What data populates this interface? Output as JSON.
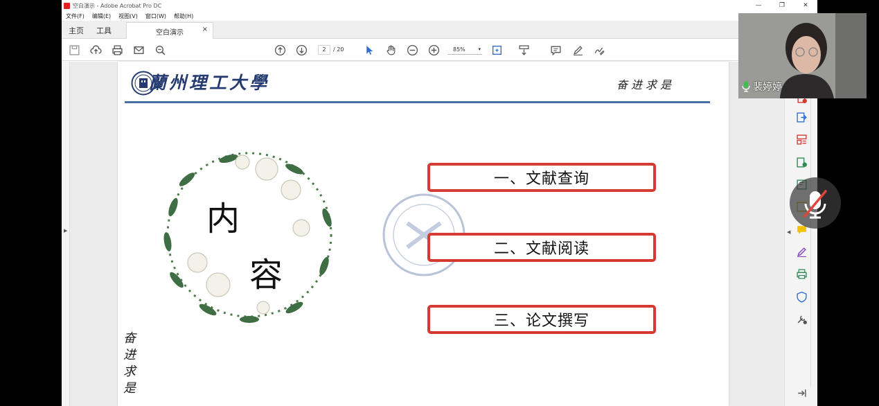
{
  "window": {
    "title": "空白演示 - Adobe Acrobat Pro DC",
    "minimize": "—",
    "restore": "❐",
    "close": "✕"
  },
  "menu": [
    "文件(F)",
    "编辑(E)",
    "视图(V)",
    "窗口(W)",
    "帮助(H)"
  ],
  "tabs": {
    "home": "主页",
    "tools": "工具",
    "doc": "空白演示",
    "doc_close": "×"
  },
  "toolbar": {
    "page_current": "2",
    "page_total": "/ 20",
    "zoom": "85%",
    "zoom_arrow": "▾"
  },
  "slide": {
    "university": "蘭州理工大學",
    "motto": "奋进求是",
    "motto_vertical": "奋进求是",
    "content_chars": [
      "内",
      "容"
    ],
    "items": [
      "一、文献查询",
      "二、文献阅读",
      "三、论文撰写"
    ]
  },
  "webcam": {
    "name": "裴婷婷"
  },
  "colors": {
    "accent_red": "#d63a32",
    "brand_blue": "#243a70",
    "divider": "#4a6fa5"
  }
}
